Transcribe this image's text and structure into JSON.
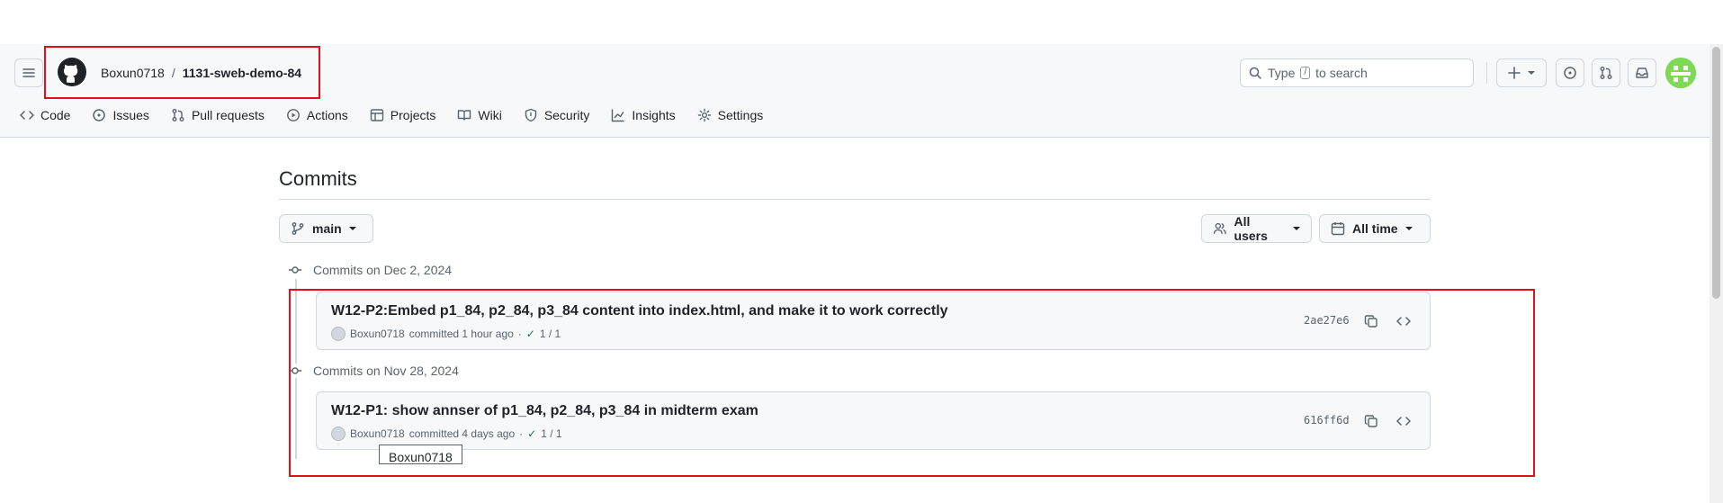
{
  "header": {
    "owner": "Boxun0718",
    "separator": "/",
    "repo": "1131-sweb-demo-84",
    "search": {
      "prefix": "Type",
      "key": "/",
      "suffix": "to search"
    }
  },
  "tabs": [
    {
      "label": "Code",
      "icon": "code-icon"
    },
    {
      "label": "Issues",
      "icon": "issue-icon"
    },
    {
      "label": "Pull requests",
      "icon": "pull-request-icon"
    },
    {
      "label": "Actions",
      "icon": "play-icon"
    },
    {
      "label": "Projects",
      "icon": "table-icon"
    },
    {
      "label": "Wiki",
      "icon": "book-icon"
    },
    {
      "label": "Security",
      "icon": "shield-icon"
    },
    {
      "label": "Insights",
      "icon": "graph-icon"
    },
    {
      "label": "Settings",
      "icon": "gear-icon"
    }
  ],
  "page": {
    "title": "Commits",
    "branch": "main",
    "users_filter": "All users",
    "time_filter": "All time"
  },
  "groups": [
    {
      "heading": "Commits on Dec 2, 2024",
      "commit": {
        "message": "W12-P2:Embed p1_84, p2_84, p3_84 content into index.html, and make it to work correctly",
        "author": "Boxun0718",
        "when": "committed 1 hour ago",
        "dot": "·",
        "checks": "1 / 1",
        "sha": "2ae27e6"
      }
    },
    {
      "heading": "Commits on Nov 28, 2024",
      "commit": {
        "message": "W12-P1: show annser of p1_84, p2_84, p3_84 in midterm exam",
        "author": "Boxun0718",
        "when": "committed 4 days ago",
        "dot": "·",
        "checks": "1 / 1",
        "sha": "616ff6d"
      }
    }
  ],
  "tooltip": "Boxun0718",
  "colors": {
    "highlight": "#e0101c",
    "success": "#1a7f37",
    "avatar": "#7ed957"
  }
}
